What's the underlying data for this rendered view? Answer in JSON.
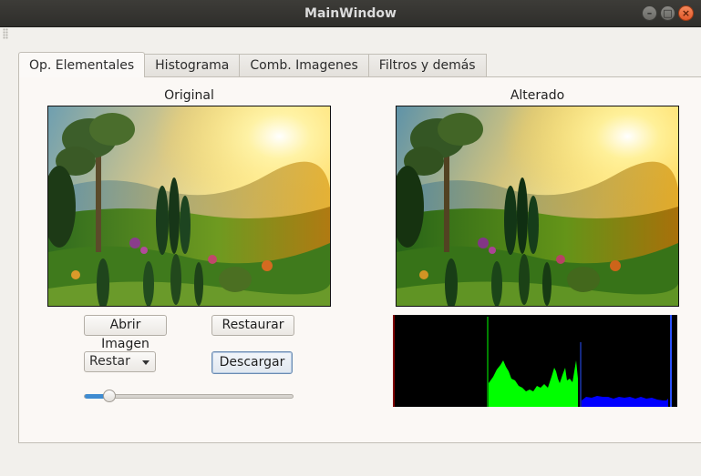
{
  "window": {
    "title": "MainWindow"
  },
  "tabs": [
    {
      "label": "Op. Elementales",
      "active": true
    },
    {
      "label": "Histograma",
      "active": false
    },
    {
      "label": "Comb. Imagenes",
      "active": false
    },
    {
      "label": "Filtros y demás",
      "active": false
    }
  ],
  "images": {
    "original_label": "Original",
    "altered_label": "Alterado"
  },
  "buttons": {
    "open_image": "Abrir Imagen",
    "restore": "Restaurar",
    "download": "Descargar"
  },
  "operation_combo": {
    "selected": "Restar"
  },
  "slider": {
    "value_fraction": 0.12
  },
  "histogram": {
    "channels": [
      "red",
      "green",
      "blue"
    ],
    "colors": {
      "red": "#ff0000",
      "green": "#00ff00",
      "blue": "#0000ff"
    }
  }
}
